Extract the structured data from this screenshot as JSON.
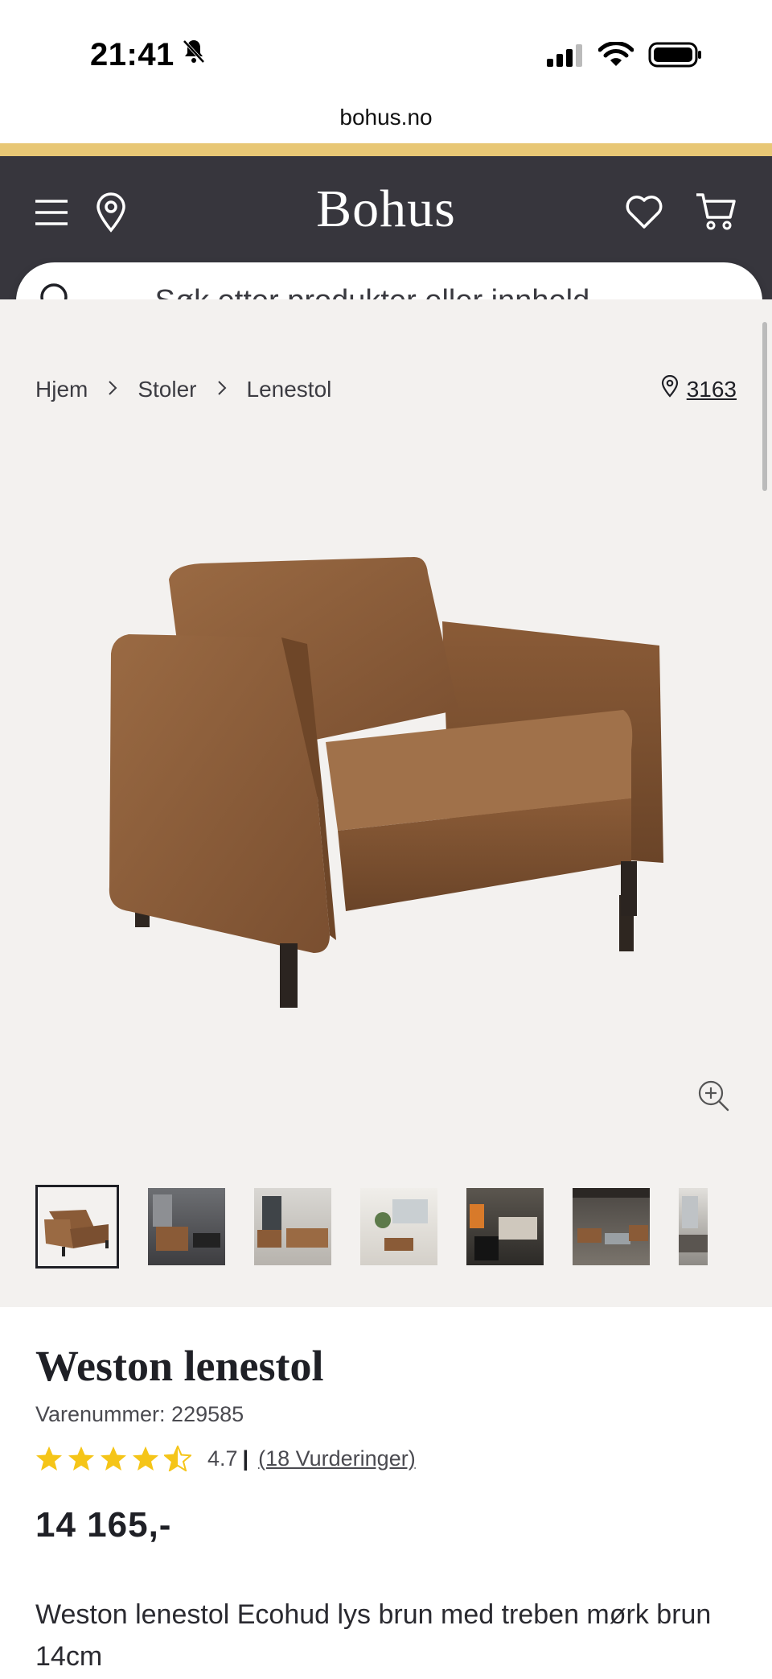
{
  "status_bar": {
    "time": "21:41"
  },
  "browser": {
    "url": "bohus.no"
  },
  "header": {
    "logo": "Bohus"
  },
  "search": {
    "placeholder": "Søk etter produkter eller innhold ..."
  },
  "breadcrumb": {
    "items": [
      "Hjem",
      "Stoler",
      "Lenestol"
    ],
    "store_number": "3163"
  },
  "gallery": {
    "thumbnails": [
      "chair-front",
      "living-room-1",
      "living-room-2",
      "living-room-3",
      "living-room-4",
      "living-room-5",
      "living-room-6"
    ]
  },
  "product": {
    "name": "Weston lenestol",
    "sku": "Varenummer: 229585",
    "rating_value": "4.7",
    "rating_separator": "|",
    "rating_count": "(18 Vurderinger)",
    "rating_stars": 4.5,
    "price": "14 165,-",
    "description": "Weston lenestol Ecohud lys brun med treben mørk brun 14cm"
  },
  "colors": {
    "header_bg": "#37363d",
    "accent_strip": "#e8c775",
    "stage_bg": "#f3f1ef",
    "star": "#f5c518"
  }
}
